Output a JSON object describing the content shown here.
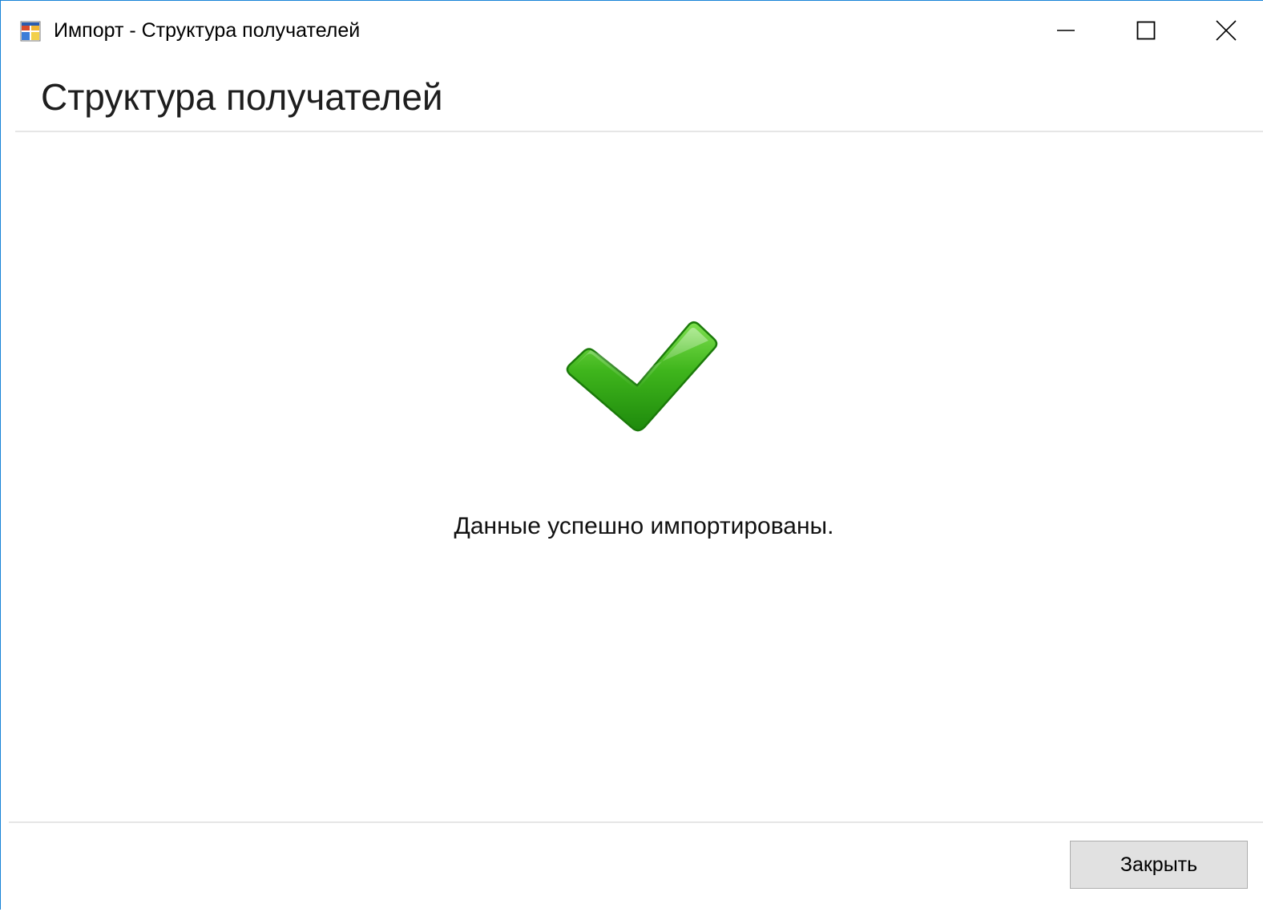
{
  "window": {
    "title": "Импорт - Структура получателей",
    "icon": "app-window-icon",
    "controls": {
      "minimize_icon": "minimize-icon",
      "maximize_icon": "maximize-icon",
      "close_icon": "close-icon"
    },
    "accent_color": "#1883d7"
  },
  "header": {
    "title": "Структура получателей"
  },
  "main": {
    "status_icon": "checkmark-icon",
    "status_color": "#3da81a",
    "message": "Данные успешно импортированы."
  },
  "footer": {
    "close_label": "Закрыть"
  }
}
